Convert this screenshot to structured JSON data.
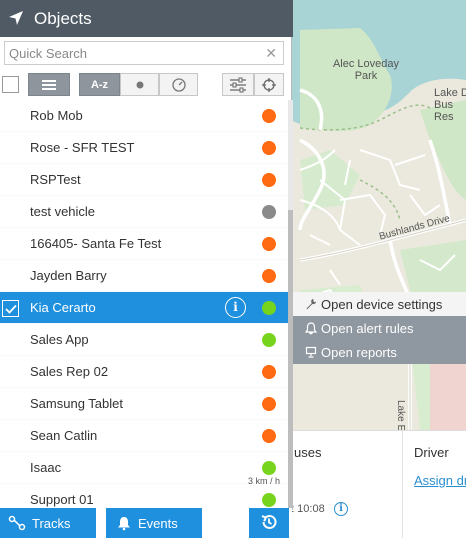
{
  "header": {
    "title": "Objects",
    "icon": "navigation-arrow-icon"
  },
  "search": {
    "placeholder": "Quick Search",
    "value": ""
  },
  "toolbar": {
    "sort_label": "A-z"
  },
  "objects": [
    {
      "name": "Rob Mob",
      "status": "orange"
    },
    {
      "name": "Rose - SFR TEST",
      "status": "orange"
    },
    {
      "name": "RSPTest",
      "status": "orange"
    },
    {
      "name": "test vehicle",
      "status": "gray"
    },
    {
      "name": "166405- Santa Fe Test",
      "status": "orange"
    },
    {
      "name": "Jayden Barry",
      "status": "orange"
    },
    {
      "name": "Kia Cerarto",
      "status": "green",
      "selected": true
    },
    {
      "name": "Sales App",
      "status": "green"
    },
    {
      "name": "Sales Rep 02",
      "status": "orange"
    },
    {
      "name": "Samsung Tablet",
      "status": "orange"
    },
    {
      "name": "Sean Catlin",
      "status": "orange"
    },
    {
      "name": "Isaac",
      "status": "green",
      "speed": "3 km / h"
    },
    {
      "name": "Support 01",
      "status": "green"
    }
  ],
  "colors": {
    "orange": "#ff6a13",
    "green": "#77d41c",
    "gray": "#8a8a8a",
    "accent": "#1f90de",
    "header": "#4f5a65"
  },
  "context_menu": [
    {
      "label": "Open device settings",
      "icon": "wrench-icon"
    },
    {
      "label": "Open alert rules",
      "icon": "bell-icon"
    },
    {
      "label": "Open reports",
      "icon": "report-icon"
    }
  ],
  "footer": {
    "tracks_label": "Tracks",
    "events_label": "Events"
  },
  "map": {
    "park_label": "Alec Loveday Park",
    "lake_label": "Lake D Bus Res",
    "road_label": "Bushlands Drive",
    "road_label_2": "Lake E"
  },
  "info_panel": {
    "col1_header": "uses",
    "col2_header": "Driver",
    "time": "2 10:08",
    "assign_link": "Assign dr"
  }
}
